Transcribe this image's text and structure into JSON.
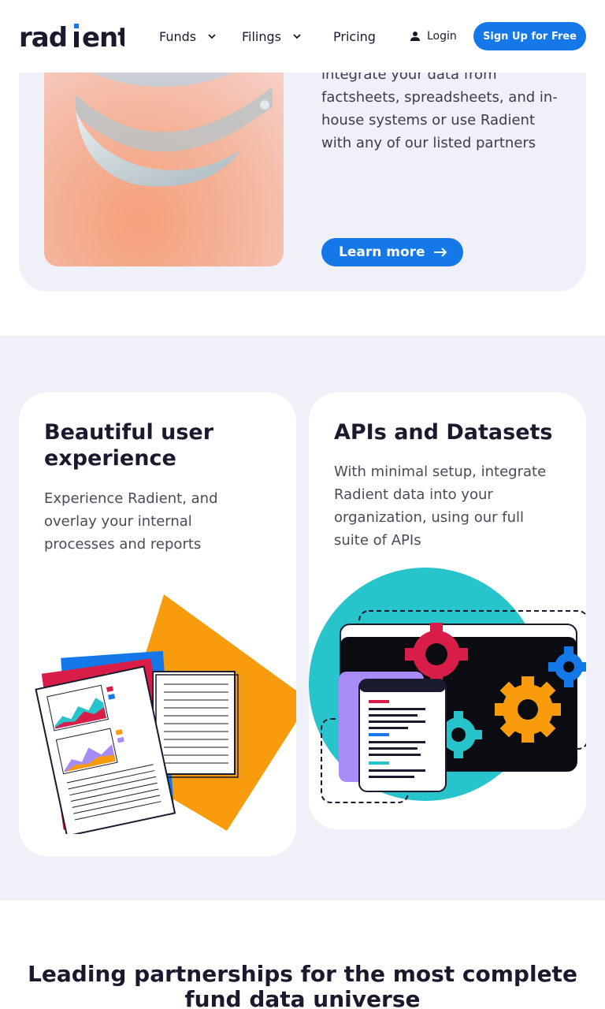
{
  "header": {
    "logo_text": "radient",
    "nav": {
      "funds": "Funds",
      "filings": "Filings",
      "pricing": "Pricing",
      "login": "Login"
    },
    "signup_label": "Sign Up for Free"
  },
  "top_card": {
    "description": "integrate your data from factsheets, spreadsheets, and in-house systems or use Radient with any of our listed partners",
    "learn_more_label": "Learn more"
  },
  "features": [
    {
      "title": "Beautiful user experience",
      "description": "Experience Radient, and overlay your internal processes and reports"
    },
    {
      "title": "APIs and Datasets",
      "description": "With minimal setup, integrate Radient data into your organization, using our full suite of APIs"
    }
  ],
  "partnerships_heading": "Leading partnerships for the most complete fund data universe",
  "colors": {
    "brand_blue": "#1478e8",
    "section_bg": "#f0f0f9",
    "orange": "#f89c0e",
    "teal": "#28c4cc",
    "crimson": "#d81e48",
    "purple": "#a98bf5"
  }
}
